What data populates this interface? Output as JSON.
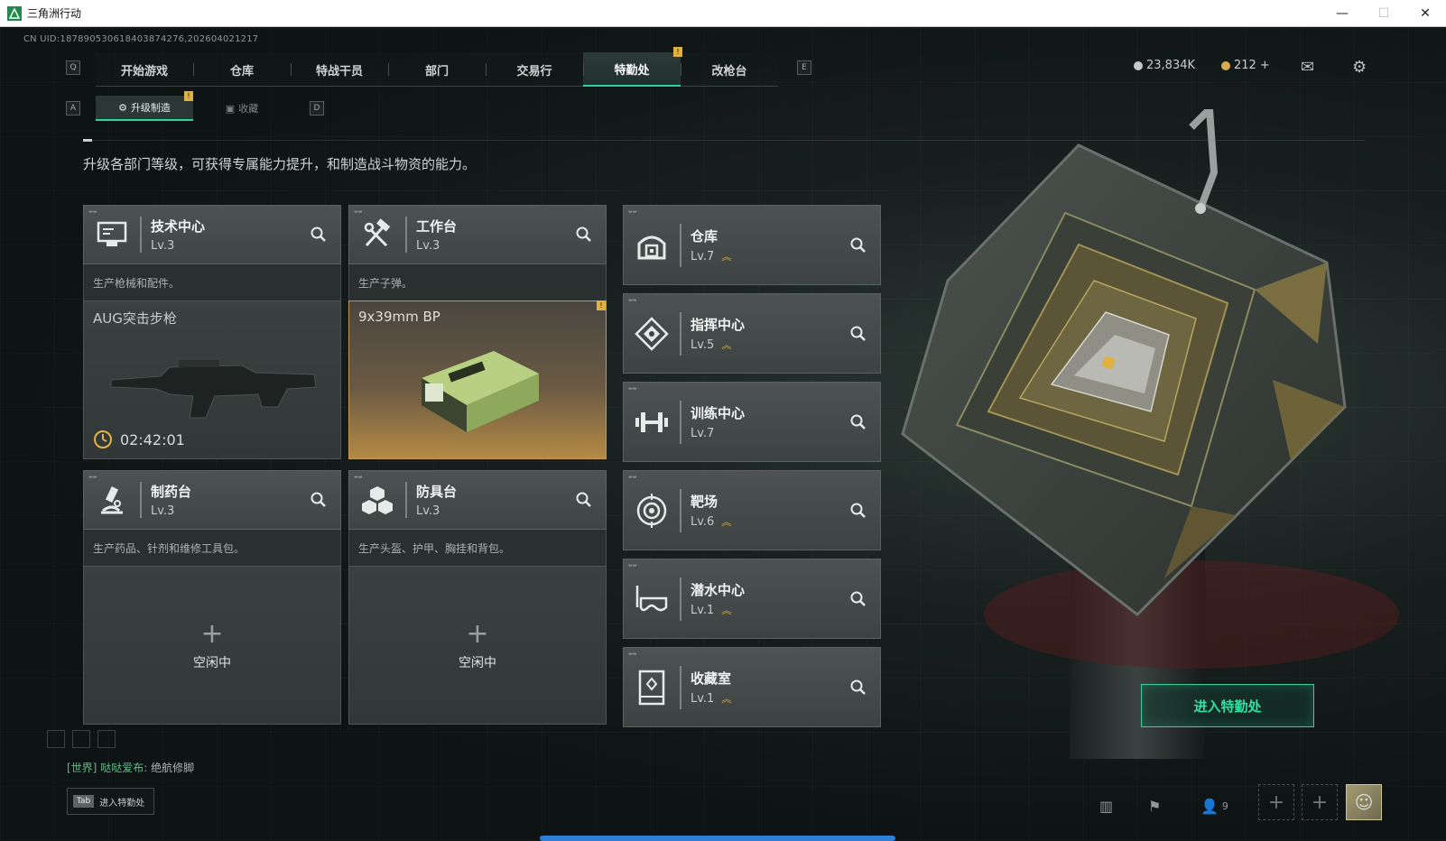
{
  "window": {
    "title": "三角洲行动",
    "minimize": "—",
    "maximize": "☐",
    "close": "✕"
  },
  "uid": "CN UID:1878905306184038742​76,202604021217",
  "topnav": {
    "left_key": "Q",
    "right_key": "E",
    "tabs": [
      {
        "label": "开始游戏"
      },
      {
        "label": "仓库"
      },
      {
        "label": "特战干员"
      },
      {
        "label": "部门"
      },
      {
        "label": "交易行"
      },
      {
        "label": "特勤处",
        "active": true,
        "badge": "!"
      },
      {
        "label": "改枪台"
      }
    ]
  },
  "currency": {
    "coins": "23,834K",
    "tokens": "212",
    "tokens_add": "+"
  },
  "subnav": {
    "left_key": "A",
    "right_key": "D",
    "tabs": [
      {
        "label": "升级制造",
        "active": true,
        "badge": "!"
      },
      {
        "label": "收藏"
      }
    ]
  },
  "description": "升级各部门等级，可获得专属能力提升，和制造战斗物资的能力。",
  "production_cards": [
    {
      "name": "技术中心",
      "level": "Lv.3",
      "sub": "生产枪械和配件。",
      "item": "AUG突击步枪",
      "timer": "02:42:01"
    },
    {
      "name": "工作台",
      "level": "Lv.3",
      "sub": "生产子弹。",
      "item": "9x39mm BP",
      "badge": "!"
    },
    {
      "name": "制药台",
      "level": "Lv.3",
      "sub": "生产药品、针剂和维修工具包。",
      "idle": "空闲中"
    },
    {
      "name": "防具台",
      "level": "Lv.3",
      "sub": "生产头盔、护甲、胸挂和背包。",
      "idle": "空闲中"
    }
  ],
  "facility_cards": [
    {
      "name": "仓库",
      "level": "Lv.7",
      "upgradable": true
    },
    {
      "name": "指挥中心",
      "level": "Lv.5",
      "upgradable": true
    },
    {
      "name": "训练中心",
      "level": "Lv.7",
      "upgradable": false
    },
    {
      "name": "靶场",
      "level": "Lv.6",
      "upgradable": true
    },
    {
      "name": "潜水中心",
      "level": "Lv.1",
      "upgradable": true
    },
    {
      "name": "收藏室",
      "level": "Lv.1",
      "upgradable": true
    }
  ],
  "enter_button": "进入特勤处",
  "chat": {
    "channel": "[世界]",
    "user": "哒哒爱布:",
    "message": "绝航修脚"
  },
  "tab_hint": {
    "key": "Tab",
    "label": "进入特勤处"
  },
  "friends_count": "9",
  "colors": {
    "accent": "#2fd49b",
    "gold": "#e4b344",
    "progress": "#2e7fd6"
  }
}
